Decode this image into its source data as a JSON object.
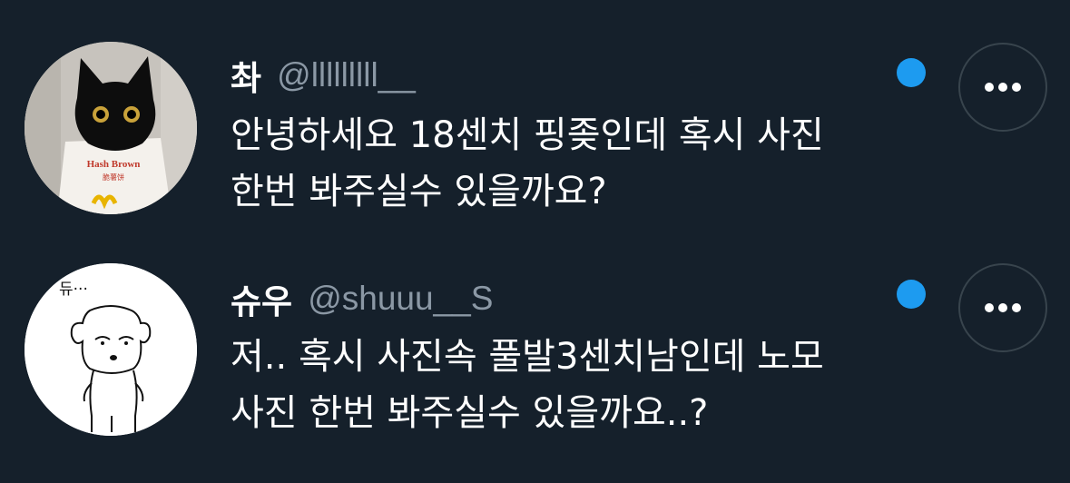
{
  "messages": [
    {
      "display_name": "촤",
      "handle": "@lllllllll__",
      "lines": [
        "안녕하세요 18센치 핑좆인데 혹시 사진",
        "한번 봐주실수 있을까요?"
      ],
      "avatar": {
        "icon": "cat-avatar-icon",
        "bag_text": "Hash Brown",
        "bag_subtext": "脆薯饼"
      },
      "unread": true
    },
    {
      "display_name": "슈우",
      "handle": "@shuuu__S",
      "lines": [
        "저.. 혹시 사진속 풀발3센치남인데 노모",
        "사진 한번 봐주실수 있을까요..?"
      ],
      "avatar": {
        "icon": "dog-avatar-icon",
        "caption": "듀···"
      },
      "unread": true
    }
  ],
  "colors": {
    "background": "#15202b",
    "text": "#ffffff",
    "handle": "#8b98a5",
    "unread_dot": "#1d9bf0",
    "button_border": "#38444d"
  }
}
